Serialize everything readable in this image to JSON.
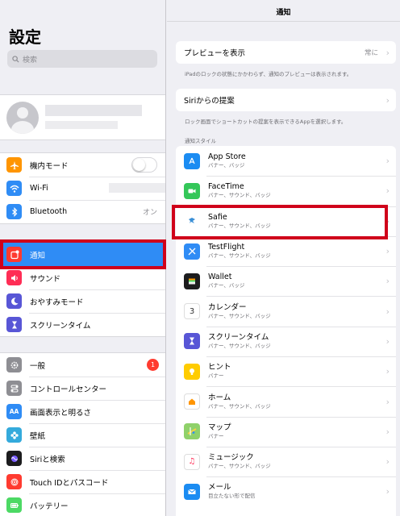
{
  "sidebar": {
    "title": "設定",
    "search_placeholder": "検索",
    "group1": [
      {
        "label": "機内モード",
        "icon": "airplane-icon",
        "color": "#ff9500"
      },
      {
        "label": "Wi-Fi",
        "icon": "wifi-icon",
        "color": "#2f8cf5"
      },
      {
        "label": "Bluetooth",
        "icon": "bluetooth-icon",
        "color": "#2f8cf5",
        "value": "オン"
      }
    ],
    "group2": [
      {
        "label": "通知",
        "icon": "notification-icon",
        "color": "#ff3b30"
      },
      {
        "label": "サウンド",
        "icon": "speaker-icon",
        "color": "#ff2d55"
      },
      {
        "label": "おやすみモード",
        "icon": "moon-icon",
        "color": "#5856d6"
      },
      {
        "label": "スクリーンタイム",
        "icon": "hourglass-icon",
        "color": "#5856d6"
      }
    ],
    "group3": [
      {
        "label": "一般",
        "icon": "gear-icon",
        "color": "#8e8e93",
        "badge": "1"
      },
      {
        "label": "コントロールセンター",
        "icon": "switches-icon",
        "color": "#8e8e93"
      },
      {
        "label": "画面表示と明るさ",
        "icon": "text-size-icon",
        "color": "#2f8cf5"
      },
      {
        "label": "壁紙",
        "icon": "flower-icon",
        "color": "#34aadc"
      },
      {
        "label": "Siriと検索",
        "icon": "siri-icon",
        "color": "#1c1c1e"
      },
      {
        "label": "Touch IDとパスコード",
        "icon": "fingerprint-icon",
        "color": "#ff3b30"
      },
      {
        "label": "バッテリー",
        "icon": "battery-icon",
        "color": "#4cd964"
      }
    ]
  },
  "detail": {
    "title": "通知",
    "preview": {
      "label": "プレビューを表示",
      "value": "常に",
      "note": "iPadのロックの状態にかかわらず、通知のプレビューは表示されます。"
    },
    "siri": {
      "label": "Siriからの提案",
      "note": "ロック画面でショートカットの提案を表示できるAppを選択します。"
    },
    "section_label": "通知スタイル",
    "apps": [
      {
        "name": "App Store",
        "sub": "バナー、バッジ",
        "icon": "app-store-icon",
        "color": "#1b8cf2"
      },
      {
        "name": "FaceTime",
        "sub": "バナー、サウンド、バッジ",
        "icon": "facetime-icon",
        "color": "#34c759"
      },
      {
        "name": "Safie",
        "sub": "バナー、サウンド、バッジ",
        "icon": "safie-icon",
        "color": "#ffffff"
      },
      {
        "name": "TestFlight",
        "sub": "バナー、サウンド、バッジ",
        "icon": "testflight-icon",
        "color": "#2f8cf5"
      },
      {
        "name": "Wallet",
        "sub": "バナー、バッジ",
        "icon": "wallet-icon",
        "color": "#1c1c1e"
      },
      {
        "name": "カレンダー",
        "sub": "バナー、サウンド、バッジ",
        "icon": "calendar-icon",
        "color": "#ffffff"
      },
      {
        "name": "スクリーンタイム",
        "sub": "バナー、サウンド、バッジ",
        "icon": "hourglass-icon",
        "color": "#5856d6"
      },
      {
        "name": "ヒント",
        "sub": "バナー",
        "icon": "lightbulb-icon",
        "color": "#ffcc00"
      },
      {
        "name": "ホーム",
        "sub": "バナー、サウンド、バッジ",
        "icon": "home-icon",
        "color": "#ffffff"
      },
      {
        "name": "マップ",
        "sub": "バナー",
        "icon": "maps-icon",
        "color": "#8fd16a"
      },
      {
        "name": "ミュージック",
        "sub": "バナー、サウンド、バッジ",
        "icon": "music-icon",
        "color": "#ffffff"
      },
      {
        "name": "メール",
        "sub": "目立たない形で配信",
        "icon": "mail-icon",
        "color": "#1b8cf2"
      }
    ]
  }
}
